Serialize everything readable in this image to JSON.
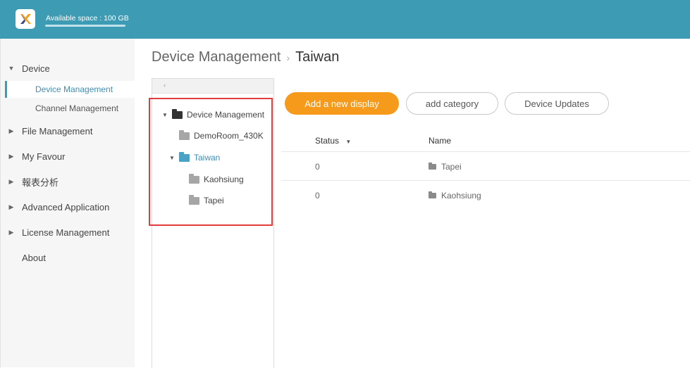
{
  "topbar": {
    "available_space": "Available space : 100 GB"
  },
  "sidebar": {
    "sections": [
      {
        "label": "Device"
      },
      {
        "label": "File Management"
      },
      {
        "label": "My Favour"
      },
      {
        "label": "報表分析"
      },
      {
        "label": "Advanced Application"
      },
      {
        "label": "License Management"
      },
      {
        "label": "About"
      }
    ],
    "sub_items": [
      {
        "label": "Device Management"
      },
      {
        "label": "Channel Management"
      }
    ]
  },
  "breadcrumb": {
    "parent": "Device Management",
    "separator": "›",
    "current": "Taiwan"
  },
  "tree": {
    "collapse_glyph": "‹",
    "nodes": [
      {
        "label": "Device Management"
      },
      {
        "label": "DemoRoom_430K"
      },
      {
        "label": "Taiwan"
      },
      {
        "label": "Kaohsiung"
      },
      {
        "label": "Tapei"
      }
    ]
  },
  "actions": {
    "add_display": "Add a new display",
    "add_category": "add category",
    "device_updates": "Device Updates"
  },
  "table": {
    "columns": [
      "Status",
      "Name"
    ],
    "rows": [
      {
        "status": "0",
        "name": "Tapei"
      },
      {
        "status": "0",
        "name": "Kaohsiung"
      }
    ]
  },
  "colors": {
    "topbar": "#3e9bb4",
    "primary_button": "#f59a1b",
    "highlight_box": "#e23c3c",
    "active_nav": "#3e8fb5"
  }
}
